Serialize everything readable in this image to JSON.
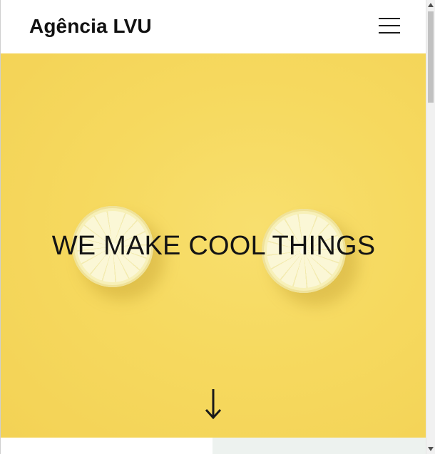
{
  "header": {
    "brand": "Agência LVU",
    "menu_icon": "hamburger-menu-icon"
  },
  "hero": {
    "title": "WE MAKE COOL THINGS",
    "background_color": "#f6d95f",
    "scroll_icon": "arrow-down-icon"
  },
  "colors": {
    "text": "#111111",
    "accent": "#f6d95f",
    "section_tint": "#edf2ef"
  },
  "scrollbar": {
    "up_icon": "scroll-up-arrow-icon",
    "down_icon": "scroll-down-arrow-icon"
  }
}
